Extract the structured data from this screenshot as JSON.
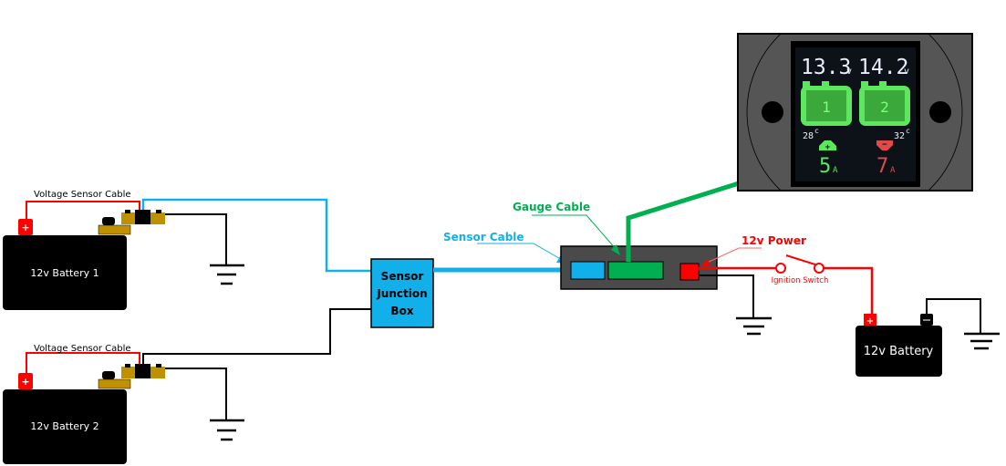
{
  "colors": {
    "sensor_cable": "#12b0ea",
    "gauge_cable": "#00b050",
    "power": "#ff0000",
    "ground": "#000000",
    "hub_body": "#4a4a4a",
    "terminal_gold": "#bf9000",
    "display_green": "#5ee65e",
    "display_white": "#e8eefc",
    "display_red": "#e04a4a"
  },
  "batteries": [
    {
      "id": "battery-1",
      "label": "12v Battery 1",
      "sensor_label": "Voltage Sensor Cable",
      "plus_symbol": "+"
    },
    {
      "id": "battery-2",
      "label": "12v Battery 2",
      "sensor_label": "Voltage Sensor Cable",
      "plus_symbol": "+"
    },
    {
      "id": "battery-main",
      "label": "12v Battery",
      "plus_symbol": "+",
      "minus_symbol": "−"
    }
  ],
  "junction_box": {
    "lines": [
      "Sensor",
      "Junction",
      "Box"
    ]
  },
  "cables": {
    "sensor_label": "Sensor Cable",
    "gauge_label": "Gauge Cable",
    "power_label": "12v Power",
    "switch_label": "Ignition Switch"
  },
  "gauge_display": {
    "battery1": {
      "voltage": "13.3",
      "unit": "v",
      "number": "1",
      "temp": "28",
      "temp_unit": "c"
    },
    "battery2": {
      "voltage": "14.2",
      "unit": "v",
      "number": "2",
      "temp": "32",
      "temp_unit": "c"
    },
    "charge": {
      "symbol": "+",
      "value": "5",
      "unit": "A"
    },
    "discharge": {
      "symbol": "−",
      "value": "7",
      "unit": "A"
    }
  }
}
